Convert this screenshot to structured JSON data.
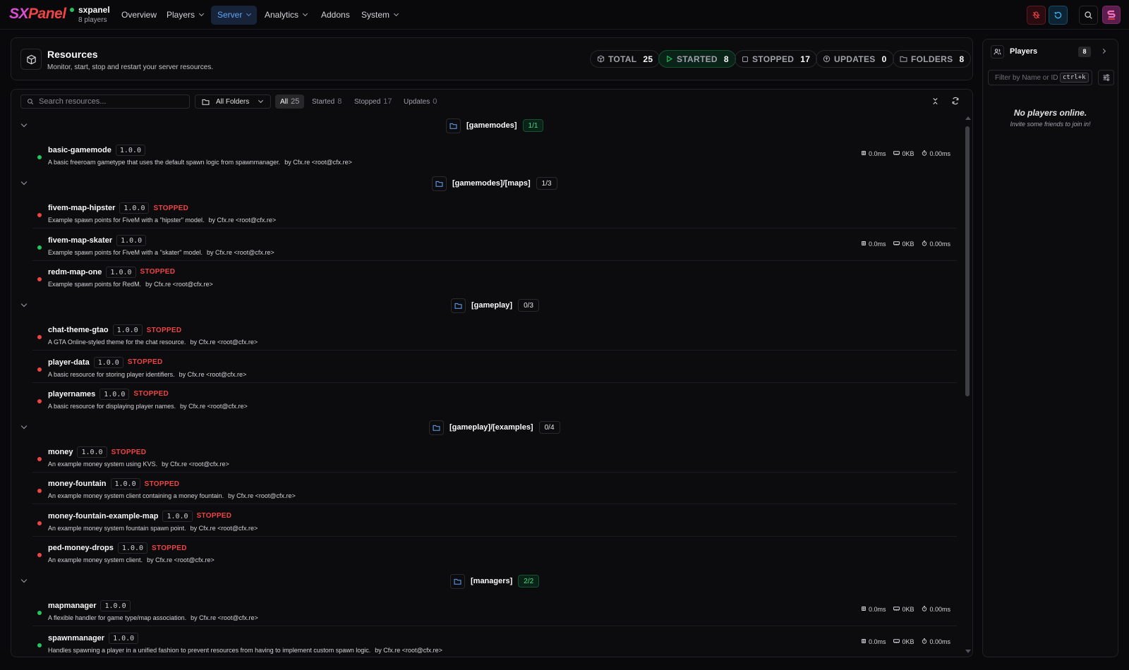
{
  "app": {
    "logo_sx": "SX",
    "logo_panel": "Panel",
    "server_name": "sxpanel",
    "server_players": "8 players",
    "colors": {
      "accent": "#60a5fa",
      "online": "#22c55e",
      "stopped": "#ef4444",
      "brand": "#d94fd0"
    }
  },
  "nav": {
    "items": [
      {
        "label": "Overview",
        "dropdown": false
      },
      {
        "label": "Players",
        "dropdown": true
      },
      {
        "label": "Server",
        "dropdown": true,
        "active": true
      },
      {
        "label": "Analytics",
        "dropdown": true
      },
      {
        "label": "Addons",
        "dropdown": false
      },
      {
        "label": "System",
        "dropdown": true
      }
    ],
    "icons": [
      "bug-off-icon",
      "refresh-icon",
      "search-icon",
      "avatar-icon"
    ]
  },
  "header": {
    "title": "Resources",
    "description": "Monitor, start, stop and restart your server resources.",
    "stats": [
      {
        "label": "TOTAL",
        "value": "25",
        "icon": "package-icon"
      },
      {
        "label": "STARTED",
        "value": "8",
        "icon": "play-icon"
      },
      {
        "label": "STOPPED",
        "value": "17",
        "icon": "square-icon"
      },
      {
        "label": "UPDATES",
        "value": "0",
        "icon": "arrow-up-circle-icon"
      },
      {
        "label": "FOLDERS",
        "value": "8",
        "icon": "folder-icon"
      }
    ]
  },
  "toolbar": {
    "search_placeholder": "Search resources...",
    "folder_select": "All Folders",
    "filters": [
      {
        "label": "All",
        "count": "25",
        "active": true
      },
      {
        "label": "Started",
        "count": "8"
      },
      {
        "label": "Stopped",
        "count": "17"
      },
      {
        "label": "Updates",
        "count": "0"
      }
    ]
  },
  "folders": [
    {
      "name": "[gamemodes]",
      "count": "1/1",
      "all_running": true,
      "resources": [
        {
          "name": "basic-gamemode",
          "version": "1.0.0",
          "running": true,
          "status": "",
          "description": "A basic freeroam gametype that uses the default spawn logic from spawnmanager.",
          "author": "by Cfx.re <root@cfx.re>",
          "cpu": "0.0ms",
          "mem": "0KB",
          "tick": "0.00ms"
        }
      ]
    },
    {
      "name": "[gamemodes]/[maps]",
      "count": "1/3",
      "all_running": false,
      "resources": [
        {
          "name": "fivem-map-hipster",
          "version": "1.0.0",
          "running": false,
          "status": "STOPPED",
          "description": "Example spawn points for FiveM with a \"hipster\" model.",
          "author": "by Cfx.re <root@cfx.re>"
        },
        {
          "name": "fivem-map-skater",
          "version": "1.0.0",
          "running": true,
          "status": "",
          "description": "Example spawn points for FiveM with a \"skater\" model.",
          "author": "by Cfx.re <root@cfx.re>",
          "cpu": "0.0ms",
          "mem": "0KB",
          "tick": "0.00ms"
        },
        {
          "name": "redm-map-one",
          "version": "1.0.0",
          "running": false,
          "status": "STOPPED",
          "description": "Example spawn points for RedM.",
          "author": "by Cfx.re <root@cfx.re>"
        }
      ]
    },
    {
      "name": "[gameplay]",
      "count": "0/3",
      "all_running": false,
      "resources": [
        {
          "name": "chat-theme-gtao",
          "version": "1.0.0",
          "running": false,
          "status": "STOPPED",
          "description": "A GTA Online-styled theme for the chat resource.",
          "author": "by Cfx.re <root@cfx.re>"
        },
        {
          "name": "player-data",
          "version": "1.0.0",
          "running": false,
          "status": "STOPPED",
          "description": "A basic resource for storing player identifiers.",
          "author": "by Cfx.re <root@cfx.re>"
        },
        {
          "name": "playernames",
          "version": "1.0.0",
          "running": false,
          "status": "STOPPED",
          "description": "A basic resource for displaying player names.",
          "author": "by Cfx.re <root@cfx.re>"
        }
      ]
    },
    {
      "name": "[gameplay]/[examples]",
      "count": "0/4",
      "all_running": false,
      "resources": [
        {
          "name": "money",
          "version": "1.0.0",
          "running": false,
          "status": "STOPPED",
          "description": "An example money system using KVS.",
          "author": "by Cfx.re <root@cfx.re>"
        },
        {
          "name": "money-fountain",
          "version": "1.0.0",
          "running": false,
          "status": "STOPPED",
          "description": "An example money system client containing a money fountain.",
          "author": "by Cfx.re <root@cfx.re>"
        },
        {
          "name": "money-fountain-example-map",
          "version": "1.0.0",
          "running": false,
          "status": "STOPPED",
          "description": "An example money system fountain spawn point.",
          "author": "by Cfx.re <root@cfx.re>"
        },
        {
          "name": "ped-money-drops",
          "version": "1.0.0",
          "running": false,
          "status": "STOPPED",
          "description": "An example money system client.",
          "author": "by Cfx.re <root@cfx.re>"
        }
      ]
    },
    {
      "name": "[managers]",
      "count": "2/2",
      "all_running": true,
      "resources": [
        {
          "name": "mapmanager",
          "version": "1.0.0",
          "running": true,
          "status": "",
          "description": "A flexible handler for game type/map association.",
          "author": "by Cfx.re <root@cfx.re>",
          "cpu": "0.0ms",
          "mem": "0KB",
          "tick": "0.00ms"
        },
        {
          "name": "spawnmanager",
          "version": "1.0.0",
          "running": true,
          "status": "",
          "description": "Handles spawning a player in a unified fashion to prevent resources from having to implement custom spawn logic.",
          "author": "by Cfx.re <root@cfx.re>",
          "cpu": "0.0ms",
          "mem": "0KB",
          "tick": "0.00ms"
        }
      ]
    }
  ],
  "players_panel": {
    "title": "Players",
    "count": "8",
    "filter_placeholder": "Filter by Name or ID",
    "shortcut": "ctrl+k",
    "empty_title": "No players online.",
    "empty_sub": "Invite some friends to join in!"
  }
}
